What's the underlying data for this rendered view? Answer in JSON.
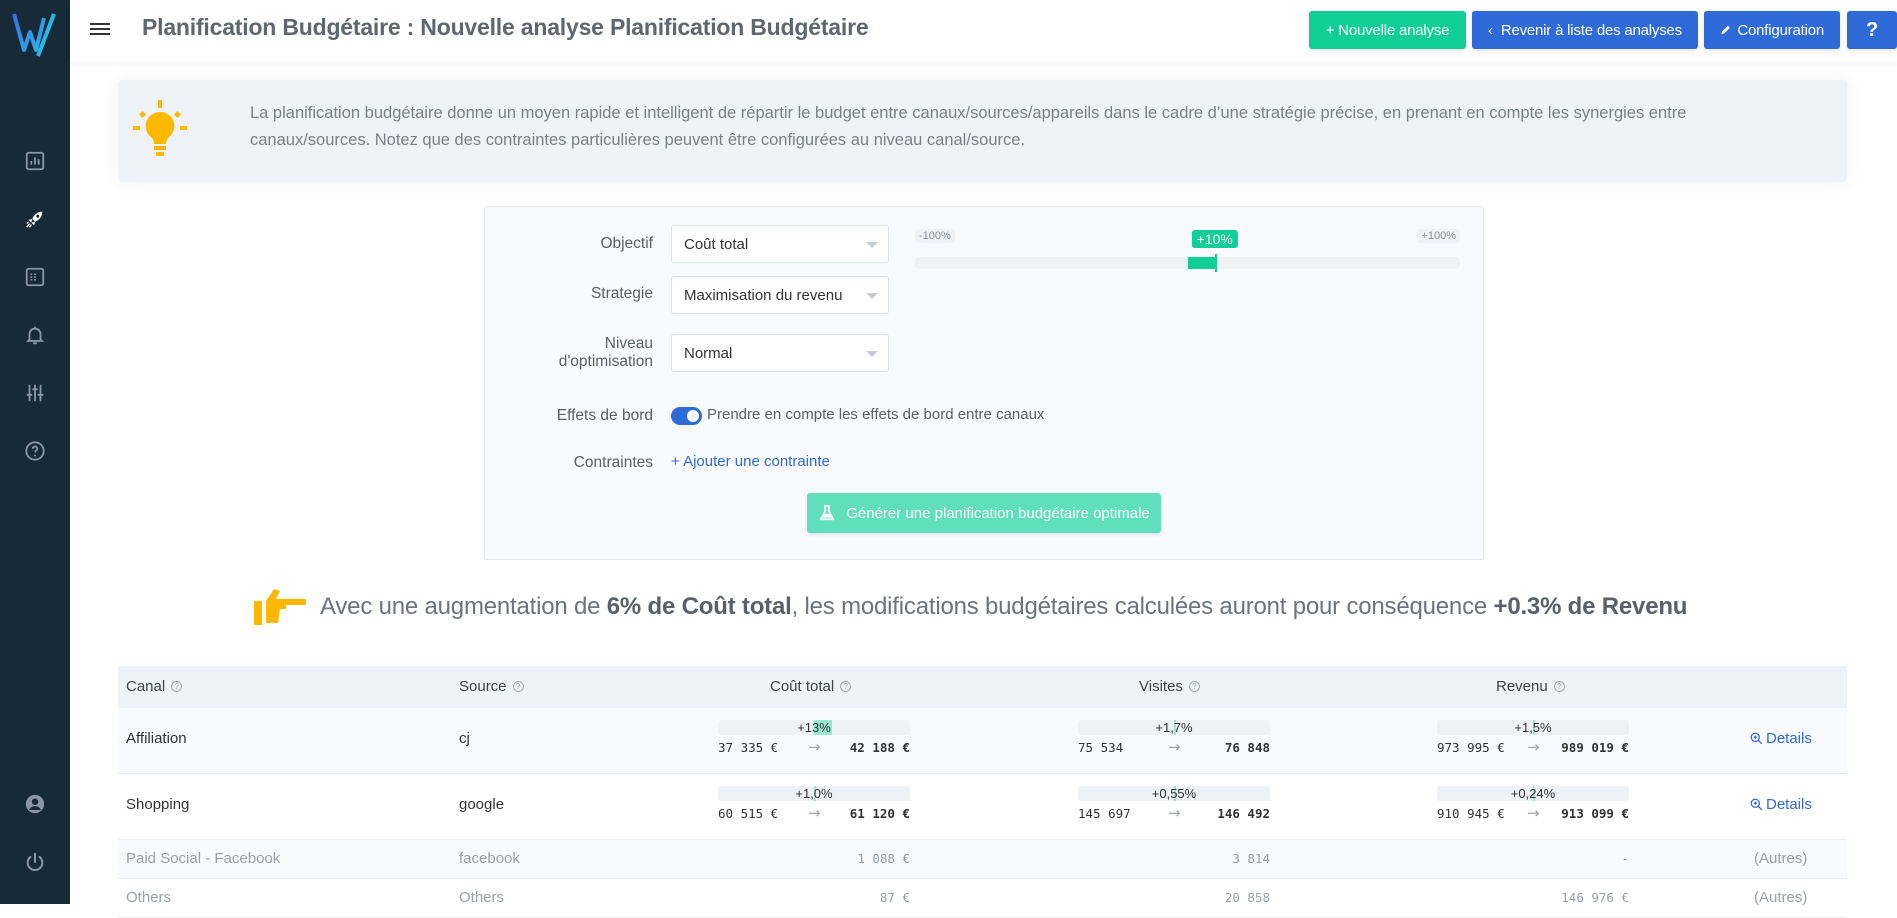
{
  "app": {
    "page_title": "Planification Budgétaire : Nouvelle analyse Planification Budgétaire",
    "colors": {
      "sidebar": "#172a37",
      "accent_green": "#0fcf96",
      "accent_blue": "#2f6bd8",
      "highlight_yellow": "#ffb800"
    }
  },
  "sidebar": {
    "logo": "wiz-logo",
    "items": [
      {
        "icon": "bar-chart-icon",
        "active": false
      },
      {
        "icon": "rocket-icon",
        "active": true
      },
      {
        "icon": "table-icon",
        "active": false
      },
      {
        "icon": "bell-icon",
        "active": false
      },
      {
        "icon": "sliders-icon",
        "active": false
      },
      {
        "icon": "help-circle-icon",
        "active": false
      }
    ],
    "bottom_items": [
      {
        "icon": "user-icon"
      },
      {
        "icon": "power-icon"
      }
    ]
  },
  "toolbar": {
    "new_analysis": "+ Nouvelle analyse",
    "back_to_list": "Revenir à liste des analyses",
    "configuration": "Configuration",
    "help": "?"
  },
  "info": {
    "text": "La planification budgétaire donne un moyen rapide et intelligent de répartir le budget entre canaux/sources/appareils dans le cadre d’une stratégie précise, en prenant en compte les synergies entre canaux/sources. Notez que des contraintes particulières peuvent être configurées au niveau canal/source."
  },
  "form": {
    "objectif_label": "Objectif",
    "objectif_value": "Coût total",
    "strategie_label": "Strategie",
    "strategie_value": "Maximisation du revenu",
    "niveau_label_1": "Niveau",
    "niveau_label_2": "d'optimisation",
    "niveau_value": "Normal",
    "slider": {
      "min_label": "-100%",
      "max_label": "+100%",
      "value_label": "+10%",
      "min": -100,
      "max": 100,
      "value": 10
    },
    "effets_label": "Effets de bord",
    "effets_enabled": true,
    "effets_text": "Prendre en compte les effets de bord entre canaux",
    "contraintes_label": "Contraintes",
    "add_constraint": "+ Ajouter une contrainte",
    "generate_button": "Générer une planification budgétaire optimale"
  },
  "summary": {
    "prefix": "Avec une augmentation de",
    "bold1": "6% de Coût total",
    "middle": ", les modifications budgétaires calculées auront pour conséquence",
    "bold2": "+0.3% de Revenu"
  },
  "table": {
    "headers": {
      "canal": "Canal",
      "source": "Source",
      "cout": "Coût total",
      "visites": "Visites",
      "revenu": "Revenu"
    },
    "details_label": "Details",
    "autres_label": "(Autres)",
    "rows": [
      {
        "canal": "Affiliation",
        "source": "cj",
        "cout": {
          "change": "+13%",
          "pct": 13,
          "from": "37 335 €",
          "to": "42 188 €"
        },
        "visites": {
          "change": "+1,7%",
          "pct": 1.7,
          "from": "75 534",
          "to": "76 848"
        },
        "revenu": {
          "change": "+1,5%",
          "pct": 1.5,
          "from": "973 995 €",
          "to": "989 019 €"
        }
      },
      {
        "canal": "Shopping",
        "source": "google",
        "cout": {
          "change": "+1,0%",
          "pct": 1.0,
          "from": "60 515 €",
          "to": "61 120 €"
        },
        "visites": {
          "change": "+0,55%",
          "pct": 0.55,
          "from": "145 697",
          "to": "146 492"
        },
        "revenu": {
          "change": "+0,24%",
          "pct": 0.24,
          "from": "910 945 €",
          "to": "913 099 €"
        }
      }
    ],
    "other_rows": [
      {
        "canal": "Paid Social - Facebook",
        "source": "facebook",
        "cout": "1 088 €",
        "visites": "3 814",
        "revenu": "-"
      },
      {
        "canal": "Others",
        "source": "Others",
        "cout": "87 €",
        "visites": "20 858",
        "revenu": "146 976 €"
      }
    ]
  }
}
